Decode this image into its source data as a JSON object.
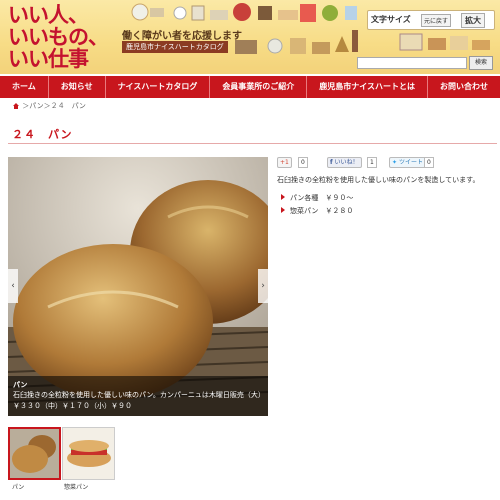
{
  "header": {
    "logo_lines": [
      "いい人、",
      "いいもの、",
      "いい仕事"
    ],
    "tagline": "働く障がい者を応援します",
    "catalog_label": "鹿児島市ナイスハートカタログ",
    "font_size_label": "文字サイズ",
    "font_reset_label": "元に戻す",
    "font_enlarge_label": "拡大",
    "search_button_label": "検索",
    "search_value": ""
  },
  "nav": {
    "items": [
      "ホーム",
      "お知らせ",
      "ナイスハートカタログ",
      "会員事業所のご紹介",
      "鹿児島市ナイスハートとは",
      "お問い合わせ"
    ]
  },
  "breadcrumb": {
    "text": "＞パン＞２４　パン"
  },
  "page": {
    "title": "２４　パン"
  },
  "slider": {
    "caption_title": "パン",
    "caption_desc": "石臼挽きの全粒粉を使用した優しい味のパン。カンパーニュは木曜日販売（大）",
    "caption_price": "￥３３０（中）￥１７０（小）￥９０",
    "thumbs": [
      {
        "label": "パン",
        "selected": true
      },
      {
        "label": "惣菜パン",
        "selected": false
      }
    ]
  },
  "social": {
    "gplus_label": "+1",
    "gplus_count": "0",
    "fb_label": "いいね！",
    "fb_count": "1",
    "tweet_label": "ツイート",
    "tweet_count": "0"
  },
  "product": {
    "description": "石臼挽きの全粒粉を使用した優しい味のパンを製造しています。",
    "items": [
      "パン各種　￥９０～",
      "惣菜パン　￥２８０"
    ]
  },
  "colors": {
    "accent": "#c8161d",
    "header_bg": "#f7dc86"
  }
}
